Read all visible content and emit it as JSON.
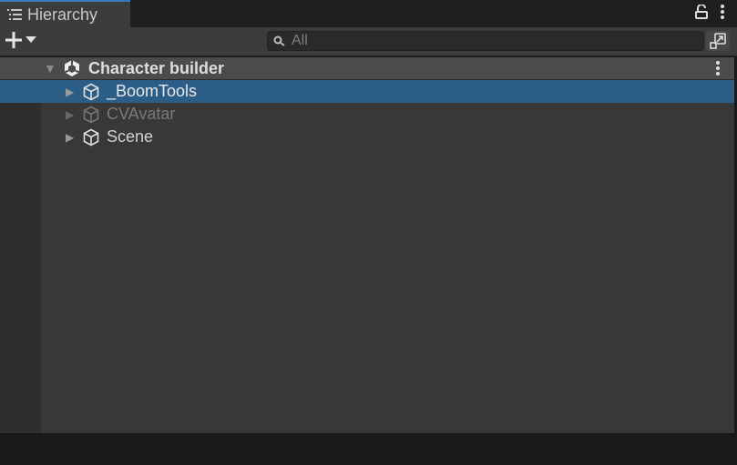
{
  "tab": {
    "title": "Hierarchy",
    "icon": "list-icon"
  },
  "tab_icons": [
    "lock-icon",
    "kebab-menu-icon"
  ],
  "toolbar": {
    "add_icon": "plus-icon",
    "dropdown_icon": "caret-down-icon",
    "search": {
      "placeholder": "All",
      "icon": "search-icon"
    },
    "search_mode_icon": "scene-search-icon"
  },
  "scene": {
    "name": "Character builder",
    "icon": "unity-logo-icon",
    "expanded": true
  },
  "items": [
    {
      "label": "_BoomTools",
      "selected": true,
      "disabled": false,
      "icon": "gameobject-cube-icon"
    },
    {
      "label": "CVAvatar",
      "selected": false,
      "disabled": true,
      "icon": "gameobject-cube-icon"
    },
    {
      "label": "Scene",
      "selected": false,
      "disabled": false,
      "icon": "gameobject-cube-icon"
    }
  ],
  "colors": {
    "selection": "#2c5d87",
    "tab_accent": "#3a79bb",
    "panel": "#383838"
  }
}
